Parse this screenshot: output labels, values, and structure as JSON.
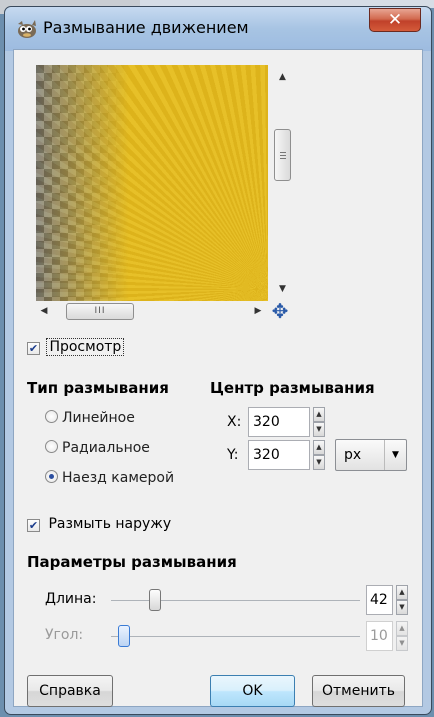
{
  "window": {
    "title": "Размывание движением",
    "close_glyph": "✕"
  },
  "preview": {
    "toggle_label": "Просмотр",
    "toggle_checked": true
  },
  "blur_type": {
    "title": "Тип размывания",
    "options": [
      {
        "label": "Линейное",
        "selected": false
      },
      {
        "label": "Радиальное",
        "selected": false
      },
      {
        "label": "Наезд камерой",
        "selected": true
      }
    ]
  },
  "blur_center": {
    "title": "Центр размывания",
    "x_label": "X:",
    "x_value": "320",
    "y_label": "Y:",
    "y_value": "320",
    "unit": "px"
  },
  "blur_outward": {
    "label": "Размыть наружу",
    "checked": true
  },
  "params": {
    "title": "Параметры размывания",
    "length_label": "Длина:",
    "length_value": "42",
    "length_fraction": 0.16,
    "angle_label": "Угол:",
    "angle_value": "10",
    "angle_fraction": 0.03
  },
  "buttons": {
    "help": "Справка",
    "ok": "OK",
    "cancel": "Отменить"
  },
  "icons": {
    "app": "gimp-wilber-icon",
    "navigate": "navigate-icon"
  }
}
